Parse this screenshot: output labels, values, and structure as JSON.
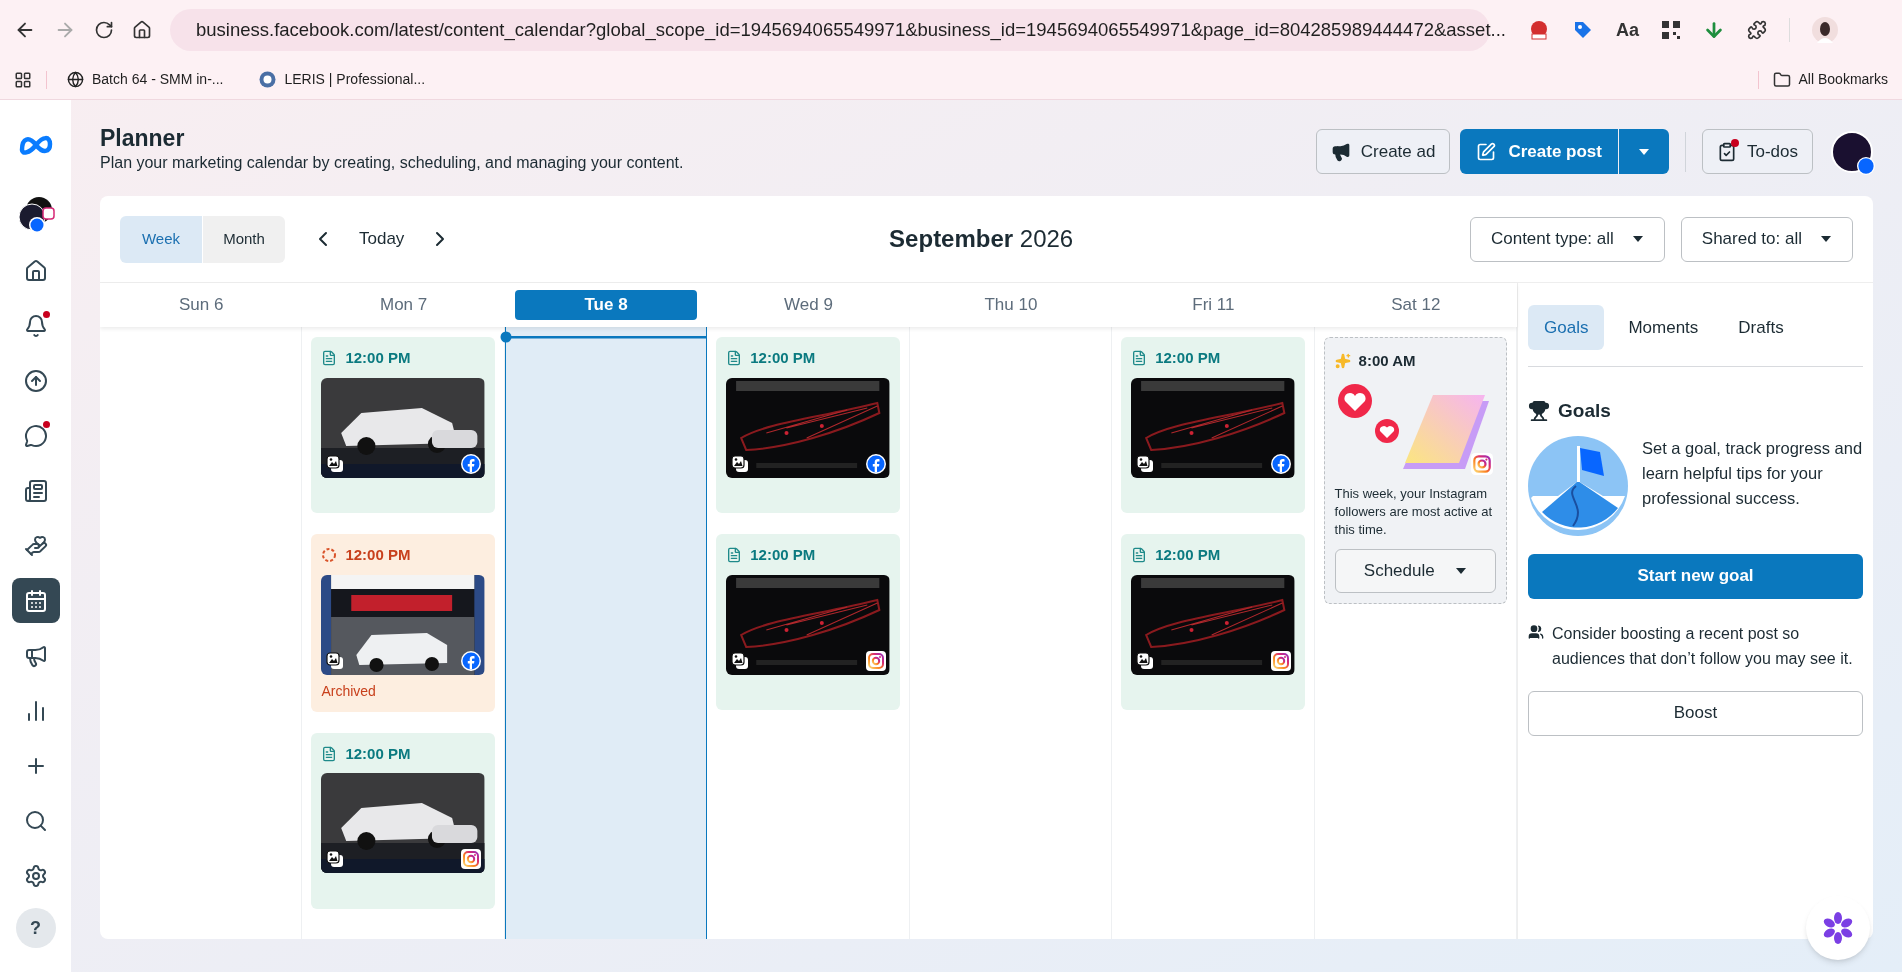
{
  "browser": {
    "url": "business.facebook.com/latest/content_calendar?global_scope_id=1945694065549971&business_id=1945694065549971&page_id=804285989444472&asset...",
    "extension_label": "Aa",
    "bookmarks": [
      {
        "label": "Batch 64 - SMM in-..."
      },
      {
        "label": "LERIS | Professional..."
      }
    ],
    "all_bookmarks": "All Bookmarks"
  },
  "sidebar": {
    "items": [
      {
        "selected": false,
        "badge": false
      },
      {
        "selected": false,
        "badge": true
      },
      {
        "selected": false,
        "badge": false
      },
      {
        "selected": false,
        "badge": true
      },
      {
        "selected": false,
        "badge": false
      },
      {
        "selected": false,
        "badge": false
      },
      {
        "selected": true,
        "badge": false
      },
      {
        "selected": false,
        "badge": false
      },
      {
        "selected": false,
        "badge": false
      },
      {
        "selected": false,
        "badge": false
      },
      {
        "selected": false,
        "badge": false
      },
      {
        "selected": false,
        "badge": false
      }
    ],
    "help": "?"
  },
  "header": {
    "title": "Planner",
    "subtitle": "Plan your marketing calendar by creating, scheduling, and managing your content.",
    "create_ad": "Create ad",
    "create_post": "Create post",
    "todos": {
      "label": "To-dos",
      "badge": true
    }
  },
  "calendar": {
    "views": [
      {
        "label": "Week",
        "selected": true
      },
      {
        "label": "Month",
        "selected": false
      }
    ],
    "today": "Today",
    "title": "**September** 2026",
    "filters": [
      {
        "label": "Content type: all"
      },
      {
        "label": "Shared to: all"
      }
    ],
    "days": [
      {
        "label": "Sun 6",
        "selected": false
      },
      {
        "label": "Mon 7",
        "selected": false,
        "posts": [
          {
            "kind": "post",
            "time": "12:00 PM",
            "platform": {
              "kind": "facebook"
            }
          },
          {
            "kind": "archived",
            "time": "12:00 PM",
            "platform": {
              "kind": "facebook"
            },
            "status": "Archived"
          },
          {
            "kind": "post",
            "time": "12:00 PM",
            "platform": {
              "kind": "instagram"
            }
          }
        ]
      },
      {
        "label": "Tue 8",
        "selected": true
      },
      {
        "label": "Wed 9",
        "selected": false,
        "posts": [
          {
            "kind": "post",
            "time": "12:00 PM",
            "platform": {
              "kind": "facebook"
            }
          },
          {
            "kind": "post",
            "time": "12:00 PM",
            "platform": {
              "kind": "instagram"
            }
          }
        ]
      },
      {
        "label": "Thu 10",
        "selected": false
      },
      {
        "label": "Fri 11",
        "selected": false,
        "posts": [
          {
            "kind": "post",
            "time": "12:00 PM",
            "platform": {
              "kind": "facebook"
            }
          },
          {
            "kind": "post",
            "time": "12:00 PM",
            "platform": {
              "kind": "instagram"
            }
          }
        ]
      },
      {
        "label": "Sat 12",
        "selected": false,
        "posts": [
          {
            "kind": "suggestion",
            "time": "8:00 AM",
            "platform": {
              "kind": "instagram"
            },
            "text": "This week, your Instagram followers are most active at this time.",
            "button": "Schedule"
          }
        ]
      }
    ]
  },
  "panel": {
    "tabs": [
      {
        "label": "Goals",
        "selected": true
      },
      {
        "label": "Moments",
        "selected": false
      },
      {
        "label": "Drafts",
        "selected": false
      }
    ],
    "heading": "Goals",
    "description": "Set a goal, track progress and learn helpful tips for your professional success.",
    "primary_button": "Start new goal",
    "tip": "Consider boosting a recent post so audiences that don’t follow you may see it.",
    "boost_button": "Boost"
  }
}
